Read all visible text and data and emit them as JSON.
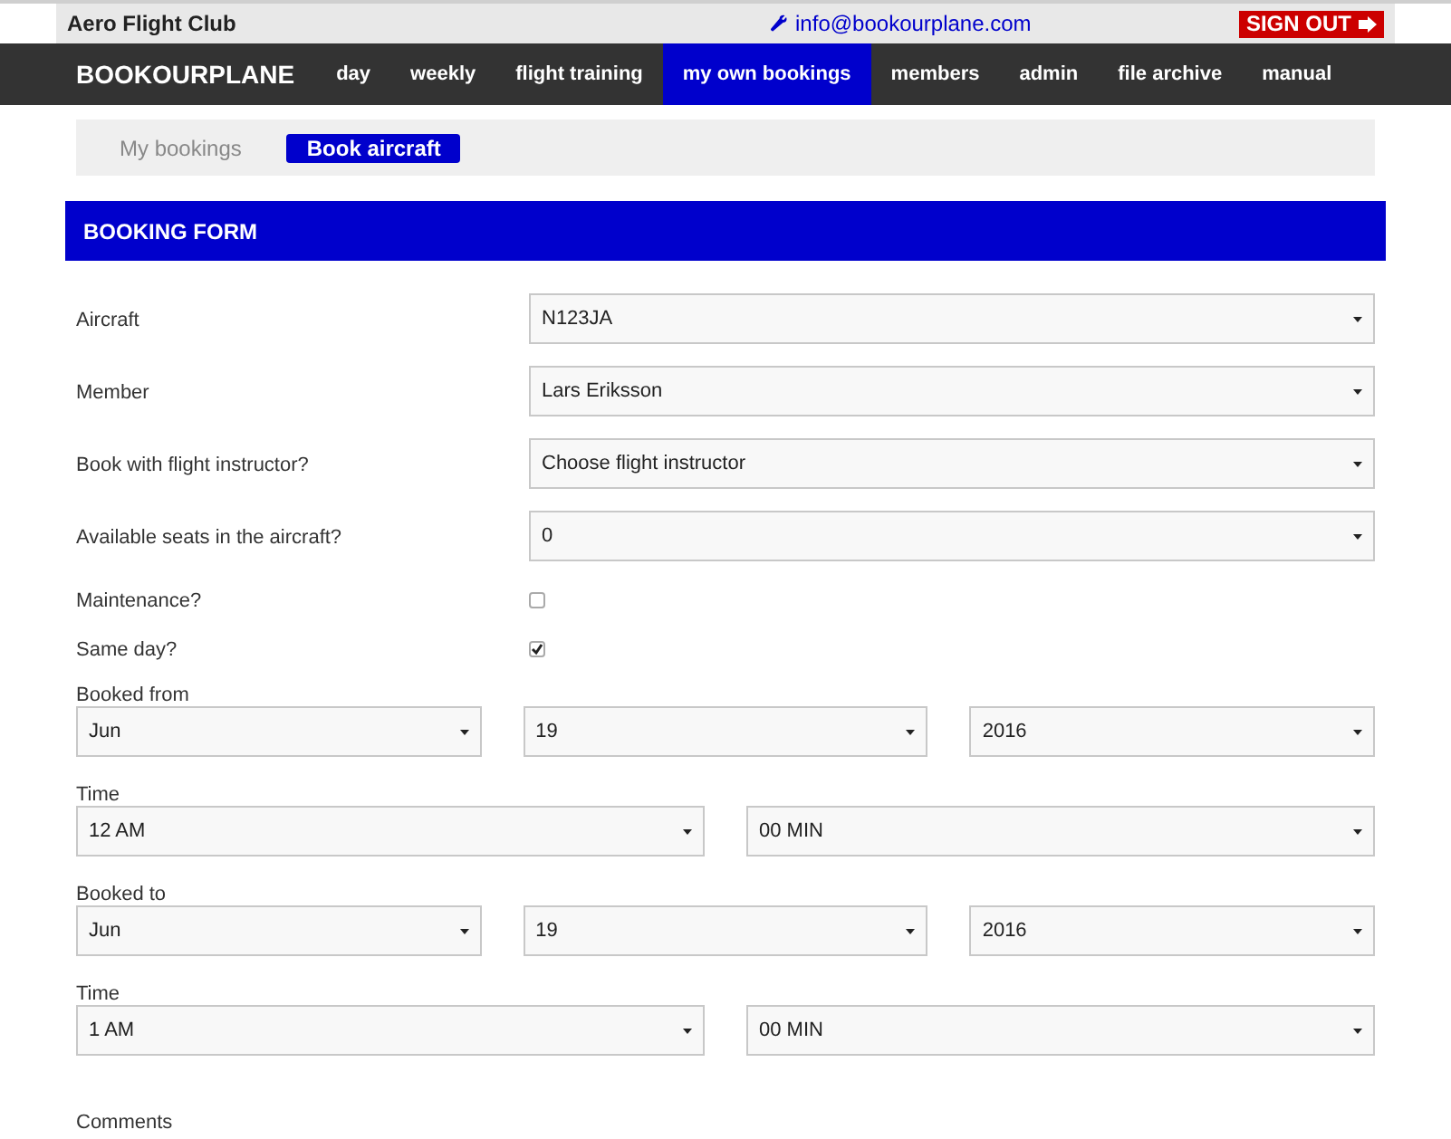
{
  "header": {
    "club_name": "Aero Flight Club",
    "email": "info@bookourplane.com",
    "sign_out": "SIGN OUT"
  },
  "nav": {
    "brand": "BOOKOURPLANE",
    "items": [
      {
        "label": "day",
        "selected": false
      },
      {
        "label": "weekly",
        "selected": false
      },
      {
        "label": "flight training",
        "selected": false
      },
      {
        "label": "my own bookings",
        "selected": true
      },
      {
        "label": "members",
        "selected": false
      },
      {
        "label": "admin",
        "selected": false
      },
      {
        "label": "file archive",
        "selected": false
      },
      {
        "label": "manual",
        "selected": false
      }
    ]
  },
  "subnav": [
    {
      "label": "My bookings",
      "selected": false
    },
    {
      "label": "Book aircraft",
      "selected": true
    }
  ],
  "form": {
    "title": "BOOKING FORM",
    "fields": [
      {
        "kind": "select",
        "label": "Aircraft",
        "value": "N123JA"
      },
      {
        "kind": "select",
        "label": "Member",
        "value": "Lars Eriksson"
      },
      {
        "kind": "select",
        "label": "Book with flight instructor?",
        "value": "Choose flight instructor"
      },
      {
        "kind": "select",
        "label": "Available seats in the aircraft?",
        "value": "0"
      },
      {
        "kind": "checkbox",
        "label": "Maintenance?",
        "checked": false
      },
      {
        "kind": "checkbox",
        "label": "Same day?",
        "checked": true
      },
      {
        "kind": "group",
        "label": "Booked from",
        "values": [
          "Jun",
          "19",
          "2016"
        ]
      },
      {
        "kind": "group",
        "label": "Time",
        "values": [
          "12 AM",
          "00 MIN"
        ]
      },
      {
        "kind": "group",
        "label": "Booked to",
        "values": [
          "Jun",
          "19",
          "2016"
        ]
      },
      {
        "kind": "group",
        "label": "Time",
        "values": [
          "1 AM",
          "00 MIN"
        ]
      },
      {
        "kind": "label",
        "label": "Comments"
      }
    ]
  }
}
